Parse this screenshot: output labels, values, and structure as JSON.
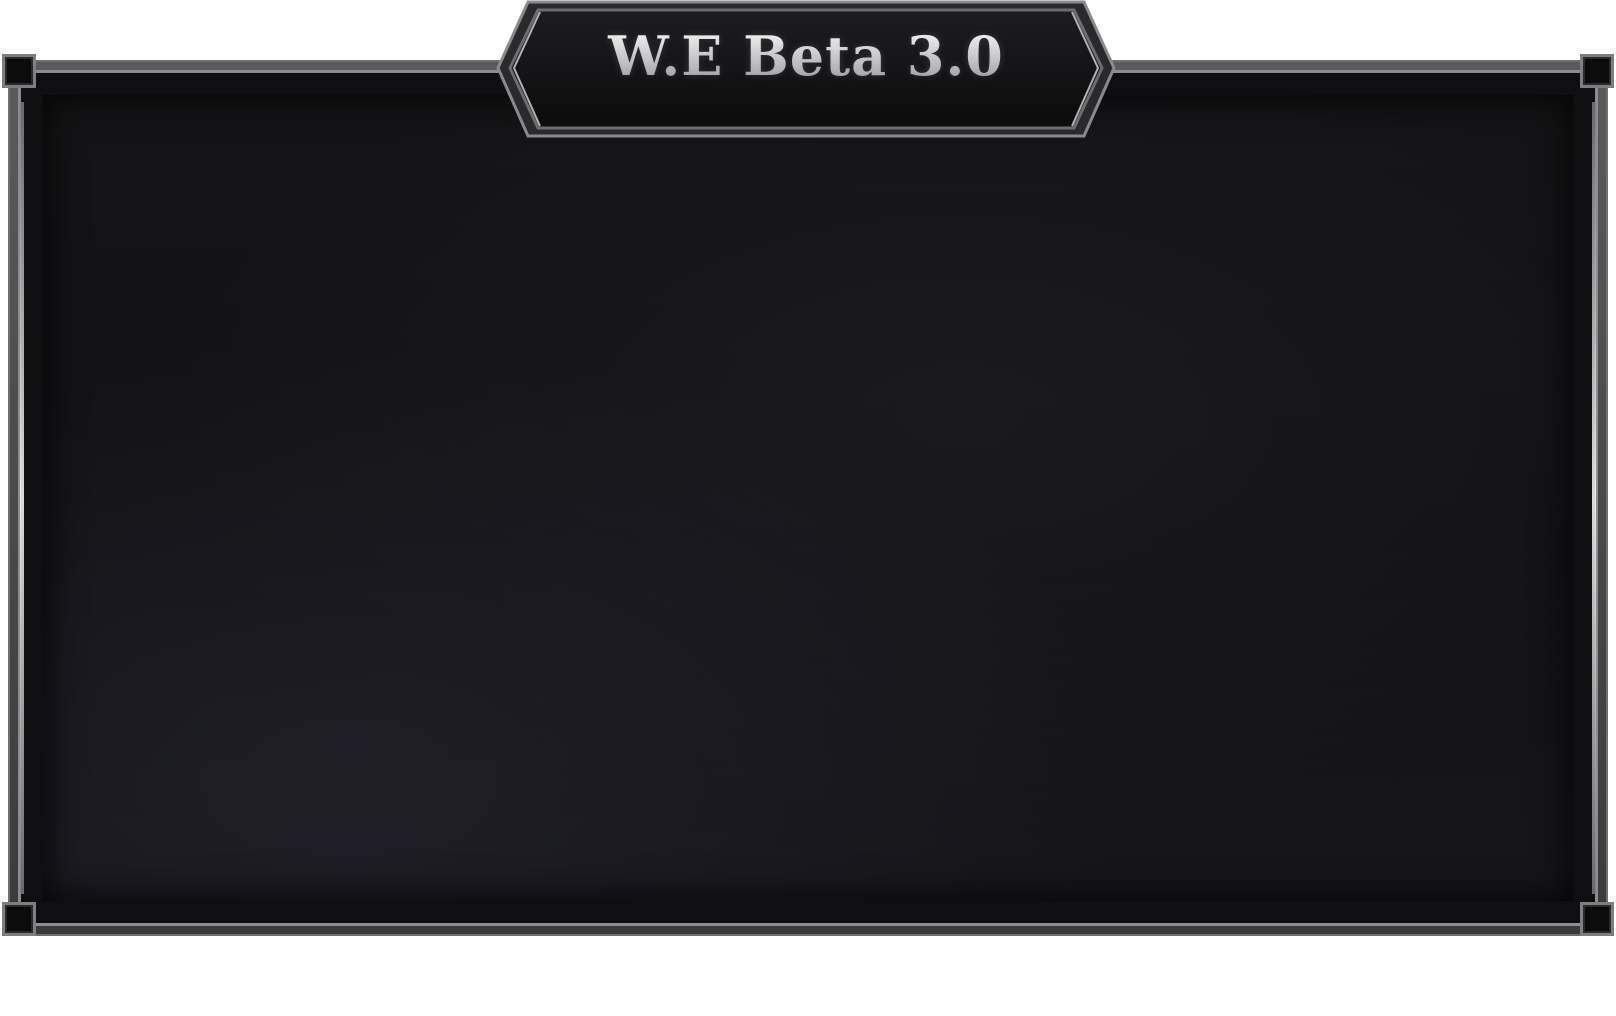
{
  "window": {
    "title": "W.E Beta 3.0"
  },
  "theme": {
    "panel_bg": "#131316",
    "frame_color": "#7e7e81",
    "title_color": "#d9d9db",
    "page_bg": "#ffffff"
  },
  "icons": {
    "corner_studs": "square-stud-icon"
  }
}
